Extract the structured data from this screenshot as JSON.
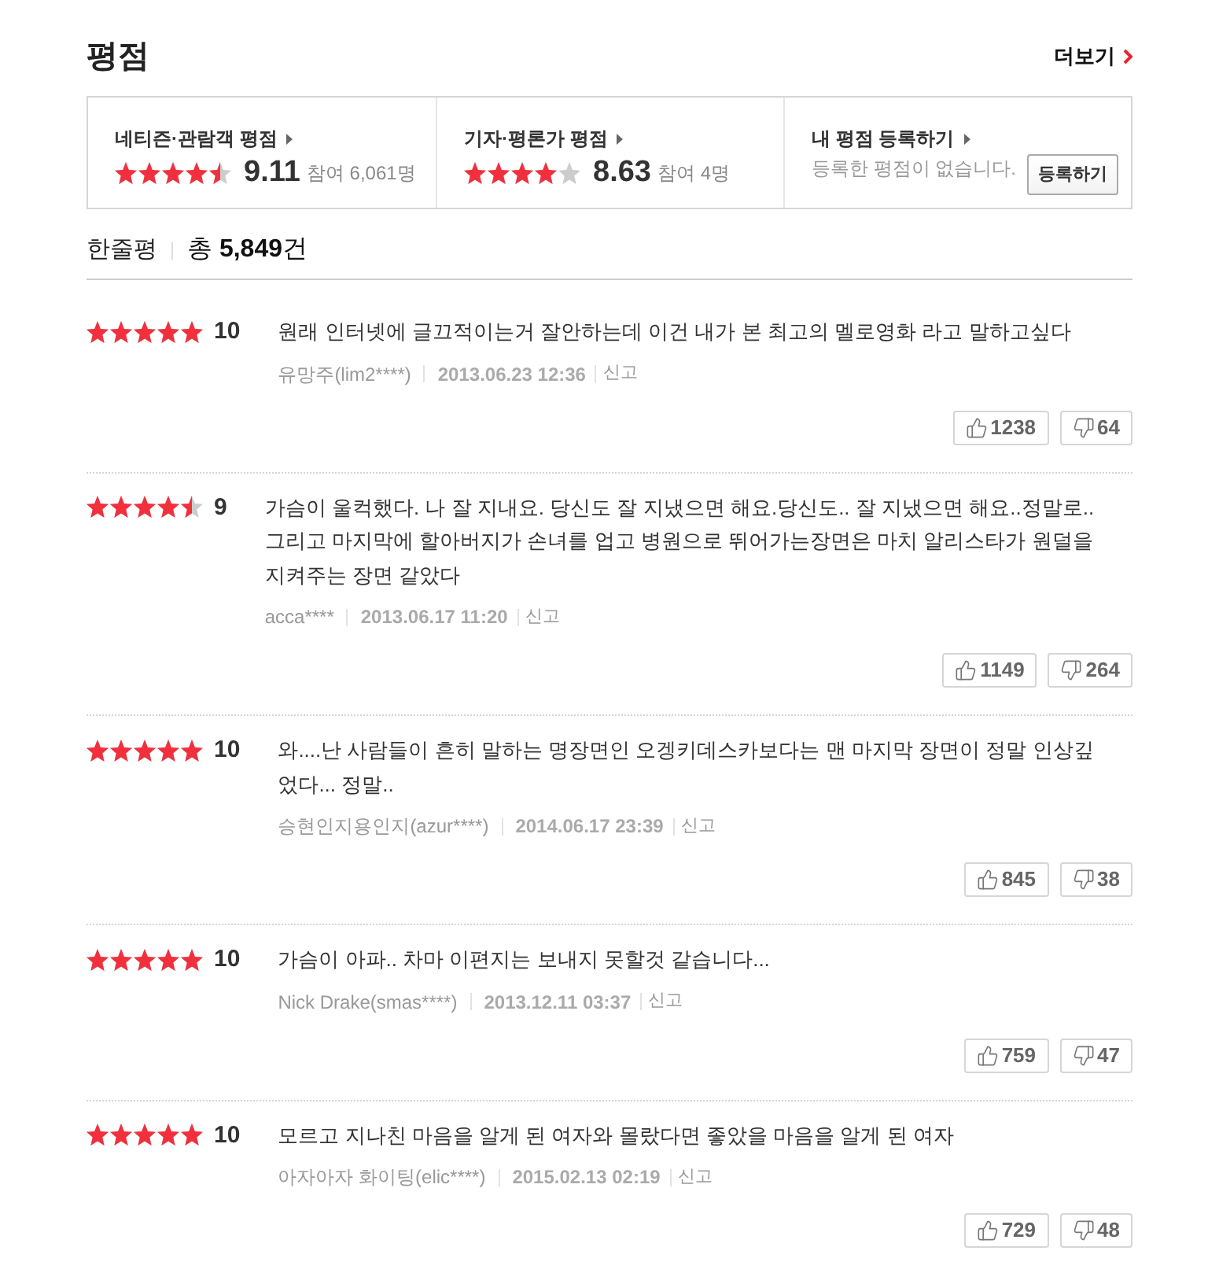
{
  "header": {
    "title": "평점",
    "more_link": "더보기"
  },
  "summary": [
    {
      "kind": "score",
      "label": "네티즌·관람객 평점",
      "stars": 4.5,
      "score": "9.11",
      "participants": "참여 6,061명"
    },
    {
      "kind": "score",
      "label": "기자·평론가 평점",
      "stars": 4,
      "score": "8.63",
      "participants": "참여 4명"
    },
    {
      "kind": "register",
      "label": "내 평점 등록하기",
      "message": "등록한 평점이 없습니다.",
      "button": "등록하기"
    }
  ],
  "reviews_header": {
    "title": "한줄평",
    "total": "총 **5,849**건"
  },
  "reviews": [
    {
      "stars": 5,
      "score": "10",
      "text": "원래 인터넷에 글끄적이는거 잘안하는데 이건 내가 본 최고의 멜로영화 라고 말하고싶다",
      "author": "유망주(lim2****)",
      "date": "2013.06.23 12:36",
      "report": "신고",
      "likes": "1238",
      "dislikes": "64"
    },
    {
      "stars": 4.5,
      "score": "9",
      "text": "가슴이 울컥했다. 나 잘 지내요. 당신도 잘 지냈으면 해요.당신도.. 잘 지냈으면 해요..정말로.. 그리고 마지막에 할아버지가 손녀를 업고 병원으로 뛰어가는장면은 마치 알리스타가 원덜을 지켜주는 장면 같았다",
      "author": "acca****",
      "date": "2013.06.17 11:20",
      "report": "신고",
      "likes": "1149",
      "dislikes": "264"
    },
    {
      "stars": 5,
      "score": "10",
      "text": "와....난 사람들이 흔히 말하는 명장면인 오겡키데스카보다는 맨 마지막 장면이 정말 인상깊었다... 정말..",
      "author": "승현인지용인지(azur****)",
      "date": "2014.06.17 23:39",
      "report": "신고",
      "likes": "845",
      "dislikes": "38"
    },
    {
      "stars": 5,
      "score": "10",
      "text": "가슴이 아파.. 차마 이편지는 보내지 못할것 같습니다...",
      "author": "Nick Drake(smas****)",
      "date": "2013.12.11 03:37",
      "report": "신고",
      "likes": "759",
      "dislikes": "47"
    },
    {
      "stars": 5,
      "score": "10",
      "text": "모르고 지나친 마음을 알게 된 여자와 몰랐다면 좋았을 마음을 알게 된 여자",
      "author": "아자아자 화이팅(elic****)",
      "date": "2015.02.13 02:19",
      "report": "신고",
      "likes": "729",
      "dislikes": "48"
    }
  ]
}
